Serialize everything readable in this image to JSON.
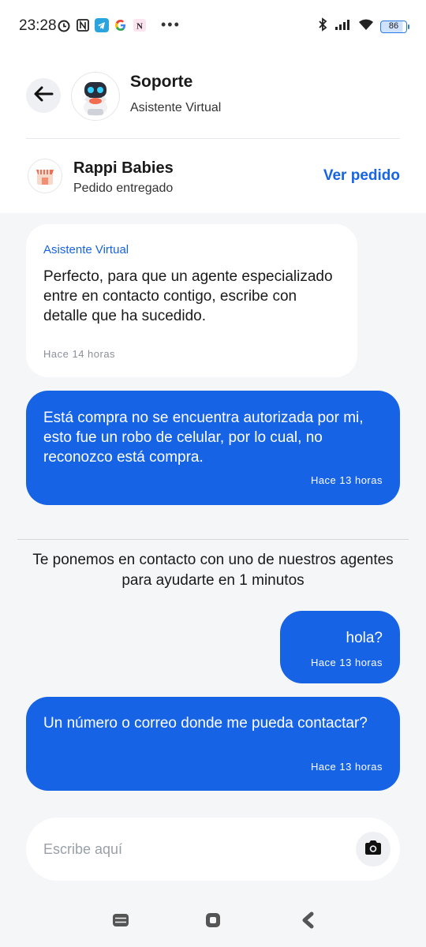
{
  "status_bar": {
    "time": "23:28",
    "left_icons": [
      "alarm-icon",
      "nfc-icon",
      "telegram-icon",
      "google-icon",
      "notion-icon"
    ],
    "more": "•••",
    "battery": "86",
    "right_icons": [
      "bluetooth-icon",
      "signal-icon",
      "wifi-icon",
      "battery-icon"
    ]
  },
  "header": {
    "title": "Soporte",
    "subtitle": "Asistente Virtual",
    "back_icon": "arrow-left-icon",
    "avatar_icon": "robot-avatar"
  },
  "order": {
    "store_name": "Rappi Babies",
    "status": "Pedido entregado",
    "action_label": "Ver pedido",
    "logo_icon": "store-icon"
  },
  "messages": [
    {
      "from": "bot",
      "sender": "Asistente Virtual",
      "text": "Perfecto, para que un agente especializado entre en contacto contigo, escribe con detalle que ha sucedido.",
      "time": "Hace 14 horas"
    },
    {
      "from": "user",
      "text": "Está compra no se encuentra autorizada por mi, esto fue un robo de celular, por lo cual, no reconozco está compra.",
      "time": "Hace 13 horas"
    },
    {
      "from": "system",
      "text": "Te ponemos en contacto con uno de nuestros agentes para ayudarte en 1 minutos"
    },
    {
      "from": "user",
      "text": "hola?",
      "time": "Hace 13 horas"
    },
    {
      "from": "user",
      "text": "Un número o correo donde me pueda contactar?",
      "time": "Hace 13 horas"
    }
  ],
  "composer": {
    "placeholder": "Escribe aquí",
    "value": "",
    "camera_icon": "camera-icon"
  },
  "nav": {
    "icons": [
      "recents-icon",
      "home-icon",
      "back-icon"
    ]
  },
  "colors": {
    "accent": "#1763e6",
    "chat_background": "#f5f6f8",
    "bubble_bot": "#ffffff"
  }
}
